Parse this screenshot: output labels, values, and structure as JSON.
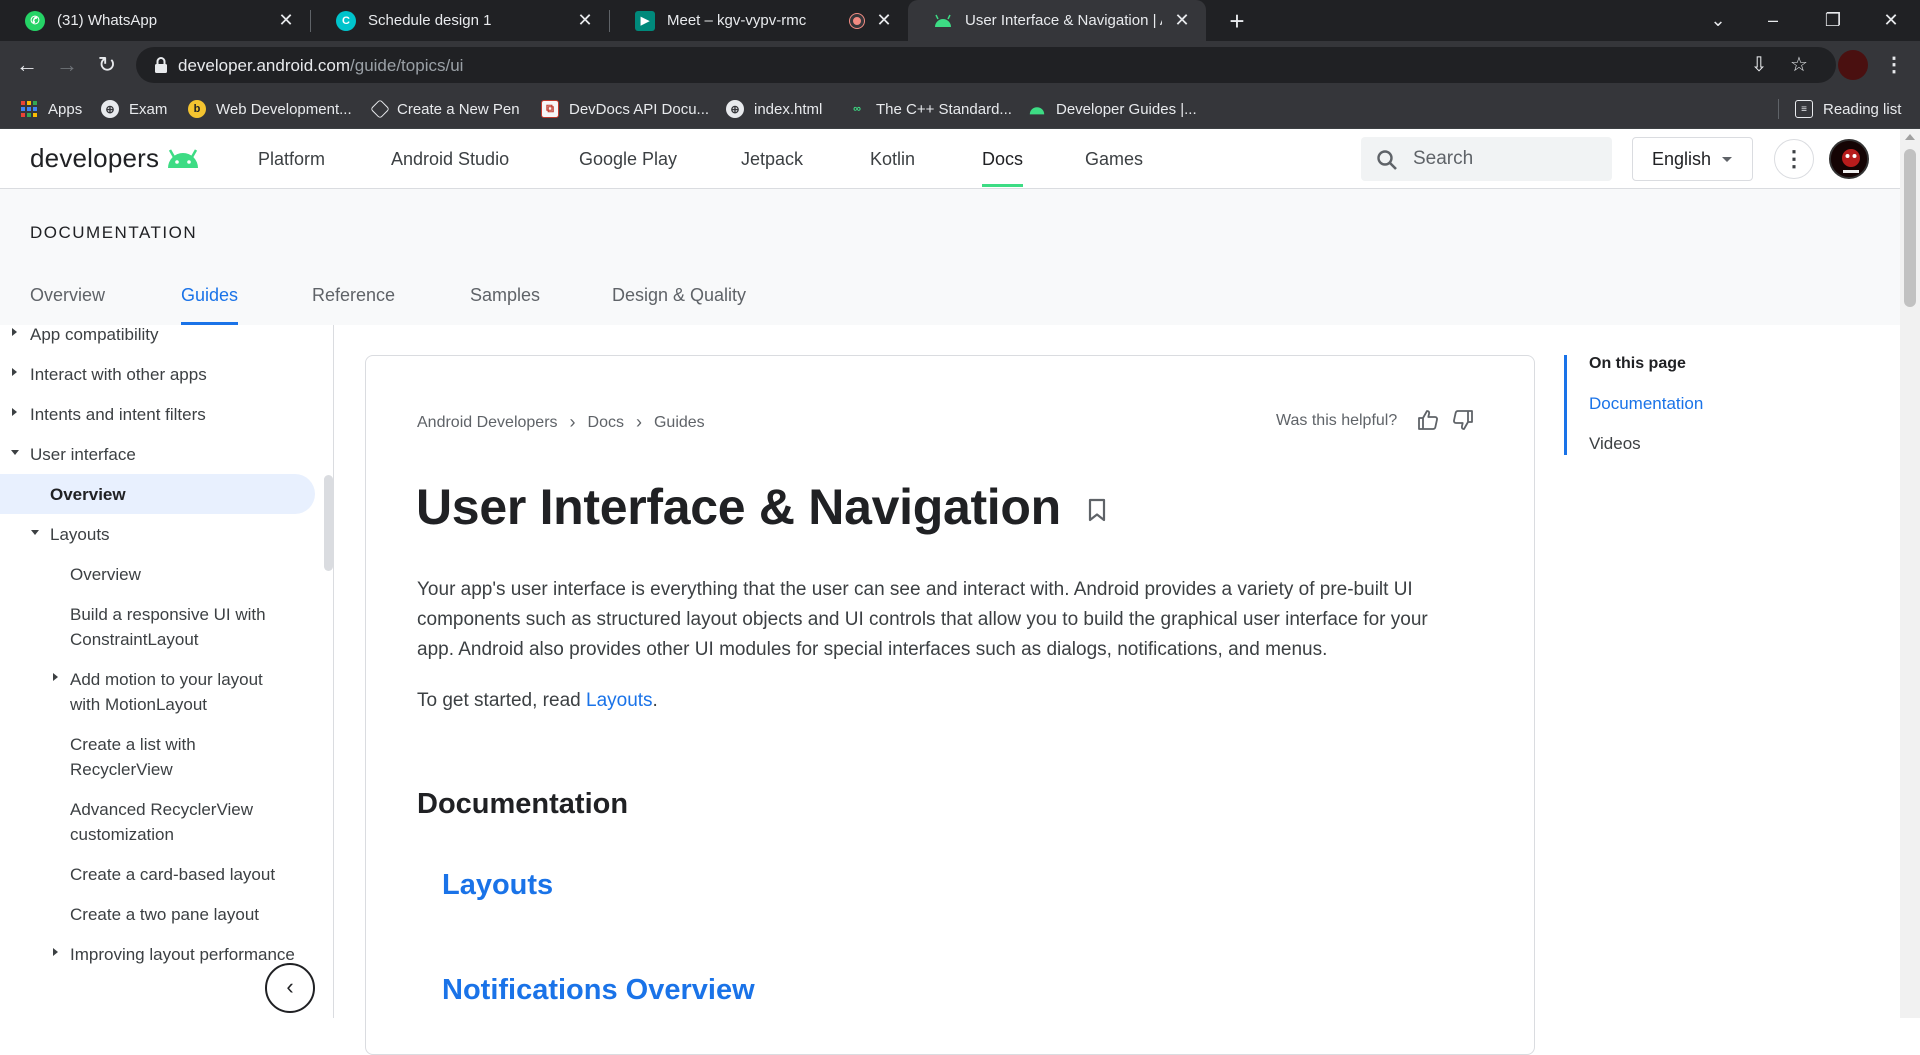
{
  "browser": {
    "tabs": [
      {
        "title": "(31) WhatsApp",
        "icon": "whatsapp-icon",
        "color": "#25d366"
      },
      {
        "title": "Schedule design 1",
        "icon": "canva-icon",
        "color": "#00c4cc"
      },
      {
        "title": "Meet – kgv-vypv-rmc",
        "icon": "meet-icon",
        "color": "#00897b"
      },
      {
        "title": "User Interface & Navigation  |  Ar",
        "icon": "android-icon",
        "color": "#3ddc84"
      }
    ],
    "url_domain": "developer.android.com",
    "url_path": "/guide/topics/ui",
    "bookmarks": [
      {
        "label": "Apps",
        "icon": "apps-grid-icon"
      },
      {
        "label": "Exam",
        "icon": "globe-icon"
      },
      {
        "label": "Web Development...",
        "icon": "web-dev-icon"
      },
      {
        "label": "Create a New Pen",
        "icon": "codepen-icon"
      },
      {
        "label": "DevDocs API Docu...",
        "icon": "devdocs-icon"
      },
      {
        "label": "index.html",
        "icon": "globe-icon"
      },
      {
        "label": "The C++ Standard...",
        "icon": "cpp-icon"
      },
      {
        "label": "Developer Guides  |...",
        "icon": "android-icon"
      }
    ],
    "reading_list": "Reading list"
  },
  "site": {
    "logo_text": "developers",
    "nav": [
      "Platform",
      "Android Studio",
      "Google Play",
      "Jetpack",
      "Kotlin",
      "Docs",
      "Games"
    ],
    "nav_selected": "Docs",
    "search_placeholder": "Search",
    "language": "English"
  },
  "doc_header": {
    "title": "DOCUMENTATION",
    "tabs": [
      "Overview",
      "Guides",
      "Reference",
      "Samples",
      "Design & Quality"
    ],
    "selected": "Guides"
  },
  "sidebar": {
    "items": [
      {
        "label": "App compatibility",
        "level": 0,
        "arrow": "right"
      },
      {
        "label": "Interact with other apps",
        "level": 0,
        "arrow": "right"
      },
      {
        "label": "Intents and intent filters",
        "level": 0,
        "arrow": "right"
      },
      {
        "label": "User interface",
        "level": 0,
        "arrow": "down"
      },
      {
        "label": "Overview",
        "level": 1,
        "arrow": "none",
        "selected": true
      },
      {
        "label": "Layouts",
        "level": 1,
        "arrow": "down"
      },
      {
        "label": "Overview",
        "level": 2,
        "arrow": "none"
      },
      {
        "label": "Build a responsive UI with ConstraintLayout",
        "level": 2,
        "arrow": "none"
      },
      {
        "label": "Add motion to your layout with MotionLayout",
        "level": 2,
        "arrow": "right"
      },
      {
        "label": "Create a list with RecyclerView",
        "level": 2,
        "arrow": "none"
      },
      {
        "label": "Advanced RecyclerView customization",
        "level": 2,
        "arrow": "none"
      },
      {
        "label": "Create a card-based layout",
        "level": 2,
        "arrow": "none"
      },
      {
        "label": "Create a two pane layout",
        "level": 2,
        "arrow": "none"
      },
      {
        "label": "Improving layout performance",
        "level": 2,
        "arrow": "right"
      }
    ]
  },
  "main": {
    "breadcrumbs": [
      "Android Developers",
      "Docs",
      "Guides"
    ],
    "helpful_prompt": "Was this helpful?",
    "title": "User Interface & Navigation",
    "intro": "Your app's user interface is everything that the user can see and interact with. Android provides a variety of pre-built UI components such as structured layout objects and UI controls that allow you to build the graphical user interface for your app. Android also provides other UI modules for special interfaces such as dialogs, notifications, and menus.",
    "get_started_prefix": "To get started, read ",
    "get_started_link": "Layouts",
    "get_started_suffix": ".",
    "section_heading": "Documentation",
    "doc_links": [
      "Layouts",
      "Notifications Overview"
    ]
  },
  "toc": {
    "title": "On this page",
    "items": [
      "Documentation",
      "Videos"
    ],
    "active": "Documentation"
  },
  "colors": {
    "accent": "#1a73e8",
    "android_green": "#3ddc84"
  }
}
